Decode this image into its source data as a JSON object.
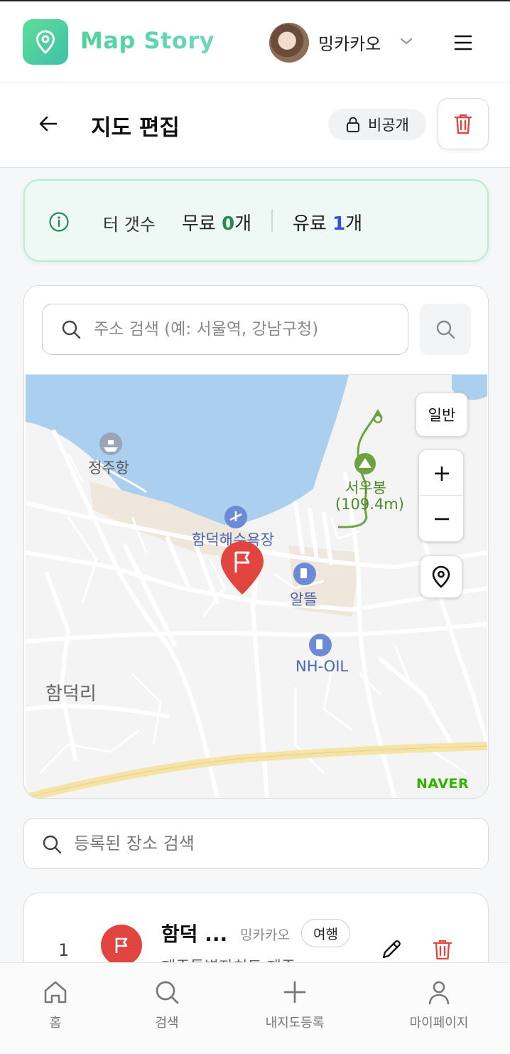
{
  "header": {
    "logo_text": "Map Story",
    "username": "밍카카오"
  },
  "titlebar": {
    "title": "지도 편집",
    "private_label": "비공개"
  },
  "count_card": {
    "label": "터 갯수",
    "free_prefix": "무료 ",
    "free_count": "0",
    "free_suffix": "개",
    "paid_prefix": "유료 ",
    "paid_count": "1",
    "paid_suffix": "개"
  },
  "map_search": {
    "placeholder": "주소 검색 (예: 서울역, 강남구청)"
  },
  "map": {
    "type_button": "일반",
    "zoom_in": "+",
    "zoom_out": "−",
    "labels": {
      "port": "정주항",
      "peak": "서우봉",
      "peak_height": "(109.4m)",
      "beach": "함덕해수욕장",
      "gas1": "알뜰",
      "gas2": "NH-OIL",
      "village": "함덕리"
    },
    "attribution": "NAVER",
    "colors": {
      "water": "#abd0ef",
      "marker": "#e0463f",
      "trail": "#6aa33f",
      "road": "#f6e3a6",
      "poi": "#6b8bd6"
    }
  },
  "place_search": {
    "placeholder": "등록된 장소 검색"
  },
  "places": [
    {
      "number": "1",
      "title": "함덕 ...",
      "owner": "밍카카오",
      "tag": "여행",
      "address": "제주특별자치도 제주"
    }
  ],
  "bottom_nav": [
    {
      "label": "홈",
      "icon": "home-icon"
    },
    {
      "label": "검색",
      "icon": "search-icon"
    },
    {
      "label": "내지도등록",
      "icon": "plus-icon"
    },
    {
      "label": "마이페이지",
      "icon": "user-icon"
    }
  ],
  "colors": {
    "accent": "#4cd39a",
    "danger": "#e0463f",
    "paid": "#2f54d6",
    "free": "#2a8a54"
  }
}
